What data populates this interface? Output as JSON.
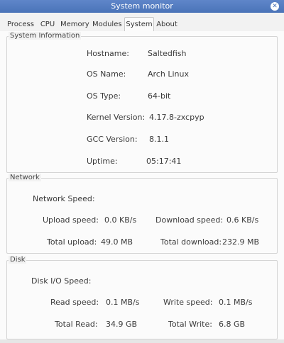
{
  "window": {
    "title": "System monitor"
  },
  "tabs": [
    {
      "label": "Process"
    },
    {
      "label": "CPU"
    },
    {
      "label": "Memory"
    },
    {
      "label": "Modules"
    },
    {
      "label": "System",
      "active": true
    },
    {
      "label": "About"
    }
  ],
  "system_info": {
    "title": "System Information",
    "rows": [
      {
        "label": "Hostname:",
        "value": "Saltedfish"
      },
      {
        "label": "OS Name:",
        "value": "Arch Linux"
      },
      {
        "label": "OS Type:",
        "value": "64-bit"
      },
      {
        "label": "Kernel Version:",
        "value": "4.17.8-zxcpyp"
      },
      {
        "label": "GCC Version:",
        "value": "8.1.1"
      },
      {
        "label": "Uptime:",
        "value": "05:17:41"
      }
    ]
  },
  "network": {
    "title": "Network",
    "speed_heading": "Network Speed:",
    "upload_speed_label": "Upload speed:",
    "upload_speed_value": "0.0 KB/s",
    "download_speed_label": "Download speed:",
    "download_speed_value": "0.6 KB/s",
    "total_upload_label": "Total upload:",
    "total_upload_value": "49.0 MB",
    "total_download_label": "Total download:",
    "total_download_value": "232.9 MB"
  },
  "disk": {
    "title": "Disk",
    "speed_heading": "Disk I/O Speed:",
    "read_speed_label": "Read speed:",
    "read_speed_value": "0.1 MB/s",
    "write_speed_label": "Write speed:",
    "write_speed_value": "0.1 MB/s",
    "total_read_label": "Total Read:",
    "total_read_value": "34.9 GB",
    "total_write_label": "Total Write:",
    "total_write_value": "6.8 GB"
  },
  "colors": {
    "titlebar": "#4a73b8",
    "background": "#f2f2f2",
    "text": "#3a3a3a"
  },
  "icons": {
    "close": "close-icon"
  }
}
